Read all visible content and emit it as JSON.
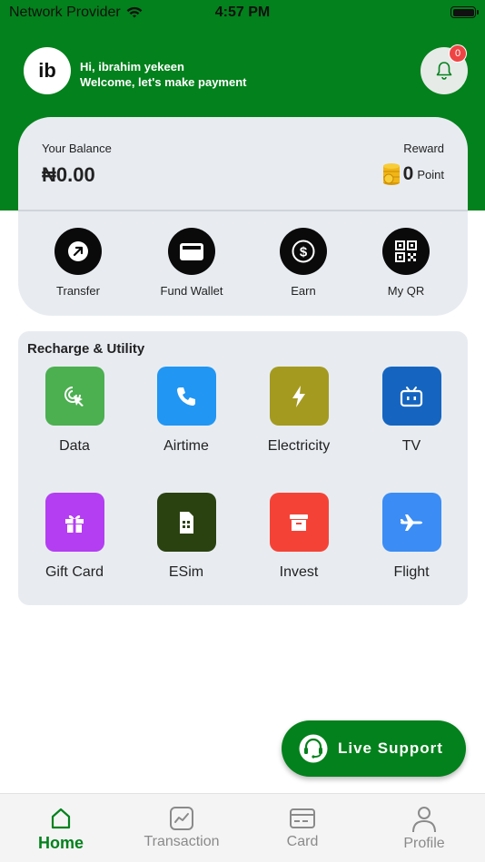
{
  "status_bar": {
    "provider": "Network Provider",
    "time": "4:57 PM"
  },
  "header": {
    "avatar_initials": "ib",
    "greeting": "Hi, ibrahim yekeen",
    "subtitle": "Welcome, let's make payment",
    "notification_count": "0"
  },
  "balance": {
    "label": "Your Balance",
    "value": "₦0.00",
    "reward_label": "Reward",
    "reward_points": "0",
    "reward_unit": "Point"
  },
  "quick_actions": [
    {
      "label": "Transfer",
      "icon": "arrow-up-right-icon"
    },
    {
      "label": "Fund Wallet",
      "icon": "wallet-icon"
    },
    {
      "label": "Earn",
      "icon": "dollar-icon"
    },
    {
      "label": "My QR",
      "icon": "qr-code-icon"
    }
  ],
  "recharge": {
    "title": "Recharge & Utility",
    "items": [
      {
        "label": "Data",
        "icon": "data-cursor-icon",
        "color": "#4caf50"
      },
      {
        "label": "Airtime",
        "icon": "phone-icon",
        "color": "#2196f3"
      },
      {
        "label": "Electricity",
        "icon": "bolt-icon",
        "color": "#a49a1f"
      },
      {
        "label": "TV",
        "icon": "tv-icon",
        "color": "#1565c0"
      },
      {
        "label": "Gift Card",
        "icon": "gift-icon",
        "color": "#b43ef2"
      },
      {
        "label": "ESim",
        "icon": "sim-card-icon",
        "color": "#2a4210"
      },
      {
        "label": "Invest",
        "icon": "archive-icon",
        "color": "#f44336"
      },
      {
        "label": "Flight",
        "icon": "airplane-icon",
        "color": "#3b8cf4"
      }
    ]
  },
  "live_support": {
    "label": "Live Support"
  },
  "nav": [
    {
      "label": "Home",
      "icon": "home-icon",
      "active": true
    },
    {
      "label": "Transaction",
      "icon": "chart-icon",
      "active": false
    },
    {
      "label": "Card",
      "icon": "card-icon",
      "active": false
    },
    {
      "label": "Profile",
      "icon": "user-icon",
      "active": false
    }
  ],
  "colors": {
    "primary_green": "#03811c",
    "card_bg": "#e8ecf1",
    "badge_red": "#ef4444"
  }
}
